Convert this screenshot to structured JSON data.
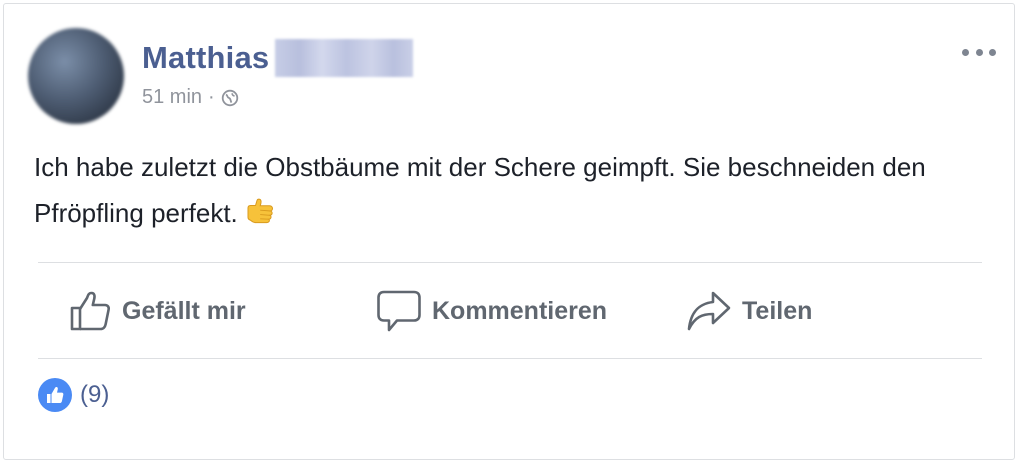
{
  "post": {
    "author_name": "Matthias",
    "time_label": "51 min",
    "separator": "·",
    "audience_icon": "globe-icon",
    "text": "Ich habe zuletzt die Obstbäume mit der Schere geimpft. Sie beschneiden den Pfröpfling perfekt.",
    "emoji": "thumbs-up-emoji"
  },
  "actions": {
    "like_label": "Gefällt mir",
    "comment_label": "Kommentieren",
    "share_label": "Teilen"
  },
  "reactions": {
    "count_label": "(9)",
    "icon": "like-reaction-icon"
  },
  "colors": {
    "name": "#4b5f91",
    "text": "#1d2129",
    "muted": "#606770",
    "meta": "#90949c",
    "like_blue": "#4a8af4",
    "divider": "#dddfe2"
  }
}
